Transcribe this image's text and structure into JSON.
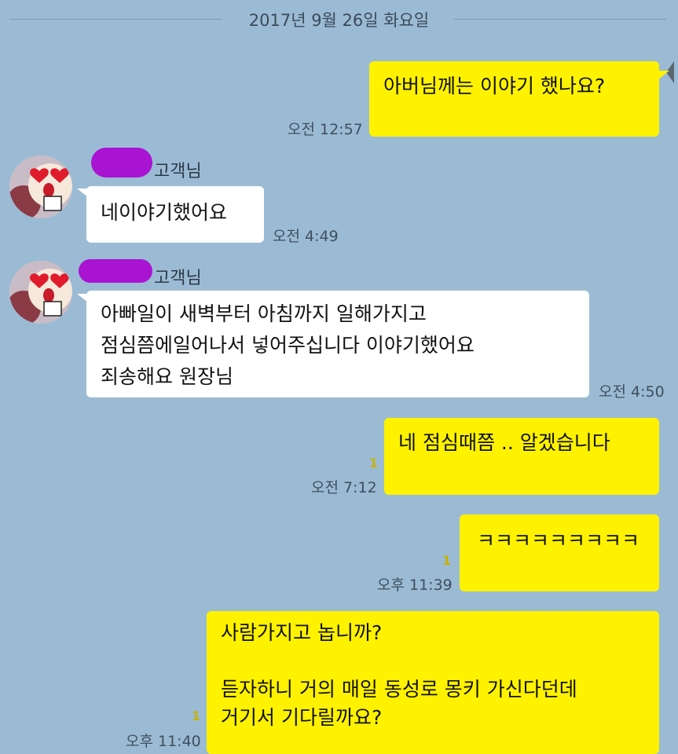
{
  "date_separator": "2017년 9월 26일 화요일",
  "contact": {
    "name_suffix": "고객님",
    "avatar_icon": "heart-eyes-face-icon"
  },
  "colors": {
    "background": "#9bbbd4",
    "my_bubble": "#fff200",
    "their_bubble": "#ffffff",
    "redaction": "#a913d2"
  },
  "messages": [
    {
      "sender": "me",
      "text": "아버님께는 이야기 했나요?",
      "time": "오전 12:57",
      "unread": ""
    },
    {
      "sender": "them",
      "text": "네이야기했어요",
      "time": "오전 4:49",
      "unread": ""
    },
    {
      "sender": "them",
      "text": "아빠일이 새벽부터 아침까지 일해가지고\n점심쯤에일어나서 넣어주십니다 이야기했어요\n죄송해요 원장님",
      "time": "오전 4:50",
      "unread": ""
    },
    {
      "sender": "me",
      "text": "네 점심때쯤 .. 알겠습니다",
      "time": "오전 7:12",
      "unread": "1"
    },
    {
      "sender": "me",
      "text": "ㅋㅋㅋㅋㅋㅋㅋㅋㅋ",
      "time": "오후 11:39",
      "unread": "1"
    },
    {
      "sender": "me",
      "text": "사람가지고 놉니까?\n\n듣자하니 거의 매일 동성로 몽키 가신다던데\n거기서 기다릴까요?",
      "time": "오후 11:40",
      "unread": "1"
    }
  ]
}
